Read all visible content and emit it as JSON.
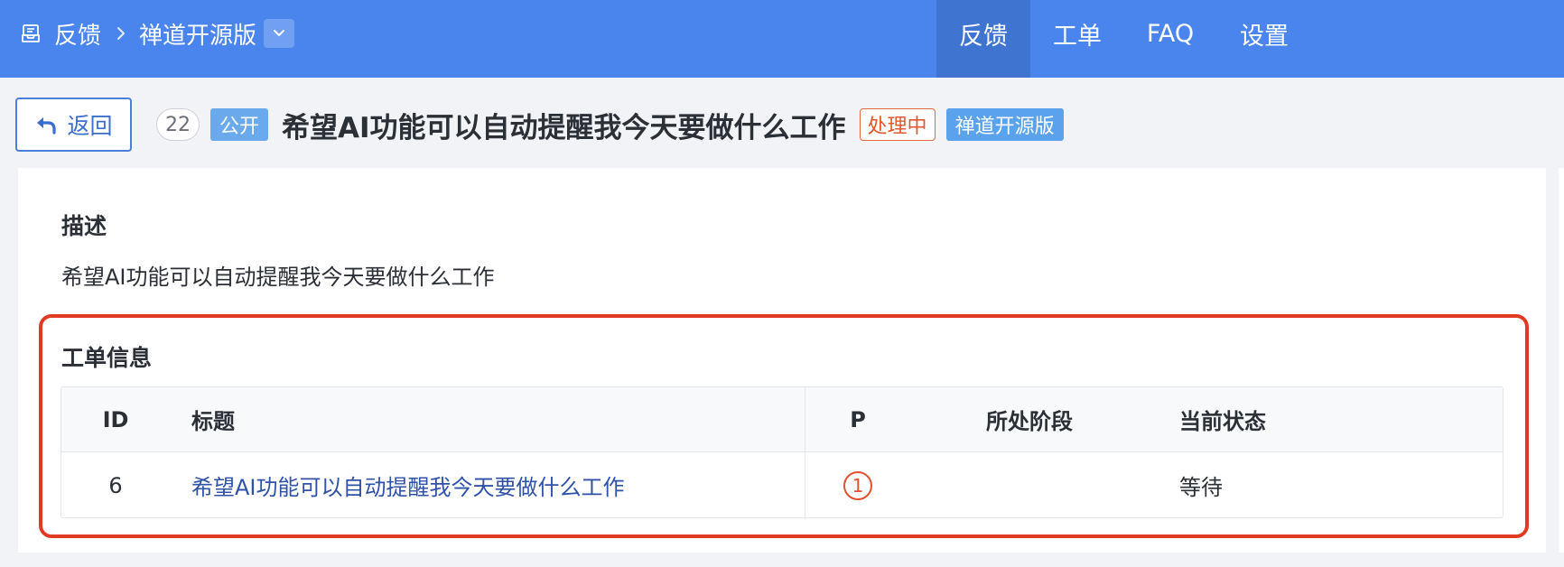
{
  "header": {
    "breadcrumb_root": "反馈",
    "product_name": "禅道开源版",
    "nav": [
      {
        "label": "反馈",
        "active": true
      },
      {
        "label": "工单",
        "active": false
      },
      {
        "label": "FAQ",
        "active": false
      },
      {
        "label": "设置",
        "active": false
      }
    ]
  },
  "feedback": {
    "back_label": "返回",
    "id": "22",
    "visibility": "公开",
    "title": "希望AI功能可以自动提醒我今天要做什么工作",
    "status": "处理中",
    "product": "禅道开源版"
  },
  "description": {
    "heading": "描述",
    "text": "希望AI功能可以自动提醒我今天要做什么工作"
  },
  "tickets": {
    "heading": "工单信息",
    "columns": {
      "id": "ID",
      "title": "标题",
      "priority": "P",
      "stage": "所处阶段",
      "status": "当前状态"
    },
    "rows": [
      {
        "id": "6",
        "title": "希望AI功能可以自动提醒我今天要做什么工作",
        "priority": "1",
        "stage": "",
        "status": "等待"
      }
    ]
  },
  "colors": {
    "header_bg": "#4a85ee",
    "header_active": "#3f74d1",
    "highlight": "#e23a22",
    "status_orange": "#e0582c",
    "link_blue": "#2f52a8"
  },
  "icons": {
    "breadcrumb": "feedback-inbox-icon",
    "separator": "chevron-right-icon",
    "product_dropdown": "chevron-down-icon",
    "back": "undo-arrow-icon"
  }
}
